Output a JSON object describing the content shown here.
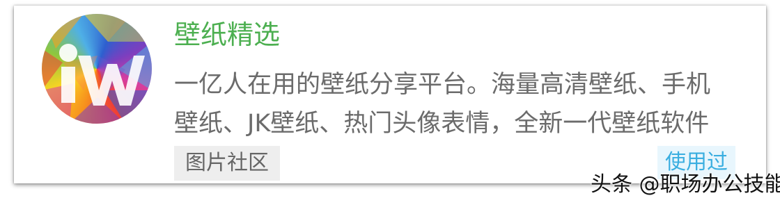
{
  "app": {
    "name": "壁纸精选",
    "description": "一亿人在用的壁纸分享平台。海量高清壁纸、手机壁纸、JK壁纸、热门头像表情，全新一代壁纸软件",
    "logo_icon": "wallpaper-app-logo-icon",
    "category_tag": "图片社区",
    "used_badge": "使用过"
  },
  "watermark": "头条 @职场办公技能",
  "colors": {
    "title": "#4caf50",
    "description": "#6b6b6b",
    "tag_bg": "#eeeeee",
    "badge_text": "#3aaee0",
    "badge_bg": "#e8f6fd"
  }
}
